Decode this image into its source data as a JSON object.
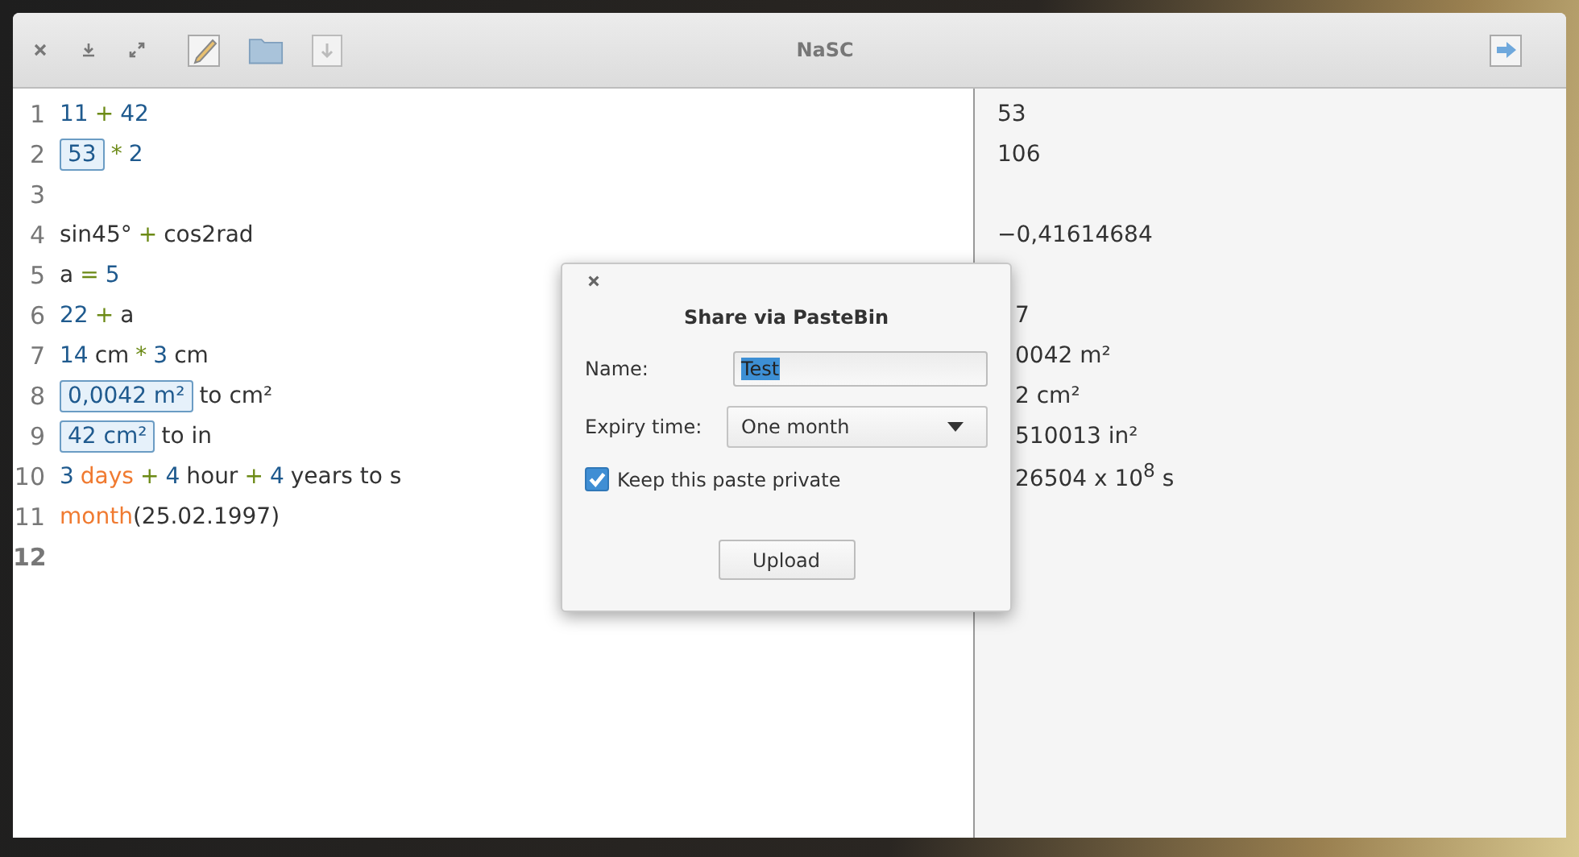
{
  "window": {
    "title": "NaSC"
  },
  "editor": {
    "lines": [
      {
        "number": "1",
        "current": false,
        "tokens": [
          {
            "kind": "number",
            "text": "11"
          },
          {
            "kind": "op",
            "text": "+"
          },
          {
            "kind": "number",
            "text": "42"
          }
        ],
        "result": {
          "text": "53",
          "covered": false
        }
      },
      {
        "number": "2",
        "current": false,
        "tokens": [
          {
            "kind": "ref",
            "text": "53"
          },
          {
            "kind": "op",
            "text": "*"
          },
          {
            "kind": "number",
            "text": "2"
          }
        ],
        "result": {
          "text": "106",
          "covered": false
        }
      },
      {
        "number": "3",
        "current": false
      },
      {
        "number": "4",
        "current": false,
        "tokens": [
          {
            "kind": "text",
            "text": "sin45°"
          },
          {
            "kind": "op",
            "text": "+"
          },
          {
            "kind": "text",
            "text": "cos2rad"
          }
        ],
        "result": {
          "text": "−0,41614684",
          "covered": false
        }
      },
      {
        "number": "5",
        "current": false,
        "tokens": [
          {
            "kind": "text",
            "text": "a"
          },
          {
            "kind": "op",
            "text": "="
          },
          {
            "kind": "number",
            "text": "5"
          }
        ]
      },
      {
        "number": "6",
        "current": false,
        "tokens": [
          {
            "kind": "number",
            "text": "22"
          },
          {
            "kind": "op",
            "text": "+"
          },
          {
            "kind": "text",
            "text": "a"
          }
        ],
        "result": {
          "text": "7",
          "covered": true
        }
      },
      {
        "number": "7",
        "current": false,
        "tokens": [
          {
            "kind": "number",
            "text": "14"
          },
          {
            "kind": "text",
            "text": "cm"
          },
          {
            "kind": "op",
            "text": "*"
          },
          {
            "kind": "number",
            "text": "3"
          },
          {
            "kind": "text",
            "text": "cm"
          }
        ],
        "result": {
          "text": "0042 m²",
          "covered": true
        }
      },
      {
        "number": "8",
        "current": false,
        "tokens": [
          {
            "kind": "ref",
            "text": "0,0042 m²"
          },
          {
            "kind": "text",
            "text": "to cm²"
          }
        ],
        "result": {
          "text": "2 cm²",
          "covered": true
        }
      },
      {
        "number": "9",
        "current": false,
        "tokens": [
          {
            "kind": "ref",
            "text": "42 cm²"
          },
          {
            "kind": "text",
            "text": "to in"
          }
        ],
        "result": {
          "text": "510013 in²",
          "covered": true
        }
      },
      {
        "number": "10",
        "current": false,
        "tokens": [
          {
            "kind": "number",
            "text": "3"
          },
          {
            "kind": "func",
            "text": "days"
          },
          {
            "kind": "op",
            "text": "+"
          },
          {
            "kind": "number",
            "text": "4"
          },
          {
            "kind": "text",
            "text": "hour"
          },
          {
            "kind": "op",
            "text": "+"
          },
          {
            "kind": "number",
            "text": "4"
          },
          {
            "kind": "text",
            "text": "years to s"
          }
        ],
        "result": {
          "text": "26504 x 10$^{8}$ s",
          "covered": true
        }
      },
      {
        "number": "11",
        "current": false,
        "tokens": [
          {
            "kind": "func",
            "text": "month"
          },
          {
            "kind": "paren",
            "text": "(25.02.1997)"
          }
        ]
      },
      {
        "number": "12",
        "current": true
      }
    ]
  },
  "dialog": {
    "title": "Share via PasteBin",
    "name_label": "Name:",
    "name_value": "Test",
    "expiry_label": "Expiry time:",
    "expiry_value": "One month",
    "private_label": "Keep this paste private",
    "private_checked": true,
    "upload_button": "Upload"
  }
}
